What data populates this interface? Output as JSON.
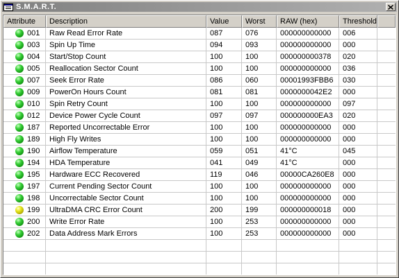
{
  "window": {
    "title": "S.M.A.R.T."
  },
  "columns": [
    "Attribute",
    "Description",
    "Value",
    "Worst",
    "RAW (hex)",
    "Threshold"
  ],
  "rows": [
    {
      "status": "green",
      "attr": "001",
      "desc": "Raw Read Error Rate",
      "value": "087",
      "worst": "076",
      "raw": "000000000000",
      "threshold": "006"
    },
    {
      "status": "green",
      "attr": "003",
      "desc": "Spin Up Time",
      "value": "094",
      "worst": "093",
      "raw": "000000000000",
      "threshold": "000"
    },
    {
      "status": "green",
      "attr": "004",
      "desc": "Start/Stop Count",
      "value": "100",
      "worst": "100",
      "raw": "000000000378",
      "threshold": "020"
    },
    {
      "status": "green",
      "attr": "005",
      "desc": "Reallocation Sector Count",
      "value": "100",
      "worst": "100",
      "raw": "000000000000",
      "threshold": "036"
    },
    {
      "status": "green",
      "attr": "007",
      "desc": "Seek Error Rate",
      "value": "086",
      "worst": "060",
      "raw": "00001993FBB6",
      "threshold": "030"
    },
    {
      "status": "green",
      "attr": "009",
      "desc": "PowerOn Hours Count",
      "value": "081",
      "worst": "081",
      "raw": "0000000042E2",
      "threshold": "000"
    },
    {
      "status": "green",
      "attr": "010",
      "desc": "Spin Retry Count",
      "value": "100",
      "worst": "100",
      "raw": "000000000000",
      "threshold": "097"
    },
    {
      "status": "green",
      "attr": "012",
      "desc": "Device Power Cycle Count",
      "value": "097",
      "worst": "097",
      "raw": "000000000EA3",
      "threshold": "020"
    },
    {
      "status": "green",
      "attr": "187",
      "desc": "Reported Uncorrectable Error",
      "value": "100",
      "worst": "100",
      "raw": "000000000000",
      "threshold": "000"
    },
    {
      "status": "green",
      "attr": "189",
      "desc": "High Fly Writes",
      "value": "100",
      "worst": "100",
      "raw": "000000000000",
      "threshold": "000"
    },
    {
      "status": "green",
      "attr": "190",
      "desc": "Airflow Temperature",
      "value": "059",
      "worst": "051",
      "raw": "41°C",
      "threshold": "045"
    },
    {
      "status": "green",
      "attr": "194",
      "desc": "HDA Temperature",
      "value": "041",
      "worst": "049",
      "raw": "41°C",
      "threshold": "000"
    },
    {
      "status": "green",
      "attr": "195",
      "desc": "Hardware ECC Recovered",
      "value": "119",
      "worst": "046",
      "raw": "00000CA260E8",
      "threshold": "000"
    },
    {
      "status": "green",
      "attr": "197",
      "desc": "Current Pending Sector Count",
      "value": "100",
      "worst": "100",
      "raw": "000000000000",
      "threshold": "000"
    },
    {
      "status": "green",
      "attr": "198",
      "desc": "Uncorrectable Sector Count",
      "value": "100",
      "worst": "100",
      "raw": "000000000000",
      "threshold": "000"
    },
    {
      "status": "yellow",
      "attr": "199",
      "desc": "UltraDMA CRC Error Count",
      "value": "200",
      "worst": "199",
      "raw": "000000000018",
      "threshold": "000"
    },
    {
      "status": "green",
      "attr": "200",
      "desc": "Write Error Rate",
      "value": "100",
      "worst": "253",
      "raw": "000000000000",
      "threshold": "000"
    },
    {
      "status": "green",
      "attr": "202",
      "desc": "Data Address Mark Errors",
      "value": "100",
      "worst": "253",
      "raw": "000000000000",
      "threshold": "000"
    }
  ],
  "empty_rows": 3,
  "colors": {
    "ok": "#1fb81f",
    "warning": "#d8d800",
    "title_bar": "#808080"
  }
}
